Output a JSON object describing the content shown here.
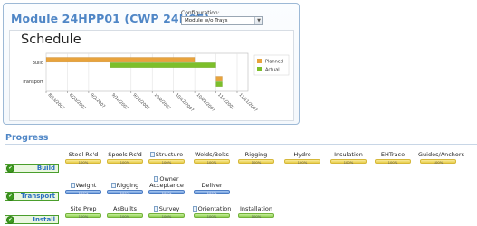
{
  "module": {
    "title": "Module 24HPP01 (CWP 24H05)",
    "config_label": "Configuration:",
    "config_value": "Module w/o Trays"
  },
  "schedule": {
    "title": "Schedule"
  },
  "chart_data": {
    "type": "bar",
    "title": "Schedule",
    "orientation": "horizontal-gantt",
    "categories": [
      "Build",
      "Transport"
    ],
    "x_ticks": [
      "8/13/2007",
      "8/23/2007",
      "9/2/2007",
      "9/12/2007",
      "9/22/2007",
      "10/2/2007",
      "10/12/2007",
      "10/22/2007",
      "11/1/2007",
      "11/11/2007"
    ],
    "series": [
      {
        "name": "Planned",
        "color": "#e8a33c",
        "values": [
          {
            "category": "Build",
            "start": "8/13/2007",
            "end": "10/22/2007"
          },
          {
            "category": "Transport",
            "start": "11/1/2007",
            "end": "11/4/2007"
          }
        ]
      },
      {
        "name": "Actual",
        "color": "#7cbf2a",
        "values": [
          {
            "category": "Build",
            "start": "9/12/2007",
            "end": "11/1/2007"
          },
          {
            "category": "Transport",
            "start": "11/1/2007",
            "end": "11/4/2007"
          }
        ]
      }
    ],
    "legend": "right"
  },
  "progress": {
    "header": "Progress",
    "rows": [
      {
        "label": "Build",
        "tasks": [
          {
            "name": "Steel Rc'd",
            "value": "100%",
            "color": "yellow",
            "doc": false
          },
          {
            "name": "Spools Rc'd",
            "value": "100%",
            "color": "yellow",
            "doc": false
          },
          {
            "name": "Structure",
            "value": "100%",
            "color": "yellow",
            "doc": true
          },
          {
            "name": "Welds/Bolts",
            "value": "100%",
            "color": "yellow",
            "doc": false
          },
          {
            "name": "Rigging",
            "value": "100%",
            "color": "yellow",
            "doc": false
          },
          {
            "name": "Hydro",
            "value": "100%",
            "color": "yellow",
            "doc": false
          },
          {
            "name": "Insulation",
            "value": "100%",
            "color": "yellow",
            "doc": false
          },
          {
            "name": "EHTrace",
            "value": "100%",
            "color": "yellow",
            "doc": false
          },
          {
            "name": "Guides/Anchors",
            "value": "100%",
            "color": "yellow",
            "doc": false
          }
        ]
      },
      {
        "label": "Transport",
        "tasks": [
          {
            "name": "Weight",
            "value": "100%",
            "color": "blue",
            "doc": true
          },
          {
            "name": "Rigging",
            "value": "100%",
            "color": "blue",
            "doc": true
          },
          {
            "name": "Owner",
            "name2": "Acceptance",
            "value": "100%",
            "color": "blue",
            "doc": true
          },
          {
            "name": "Deliver",
            "value": "100%",
            "color": "blue",
            "doc": false
          }
        ]
      },
      {
        "label": "Install",
        "tasks": [
          {
            "name": "Site Prep",
            "value": "100%",
            "color": "green",
            "doc": false
          },
          {
            "name": "AsBuilts",
            "value": "100%",
            "color": "green",
            "doc": false
          },
          {
            "name": "Survey",
            "value": "100%",
            "color": "green",
            "doc": true
          },
          {
            "name": "Orientation",
            "value": "100%",
            "color": "green",
            "doc": true
          },
          {
            "name": "Installation",
            "value": "100%",
            "color": "green",
            "doc": false
          }
        ]
      }
    ]
  }
}
